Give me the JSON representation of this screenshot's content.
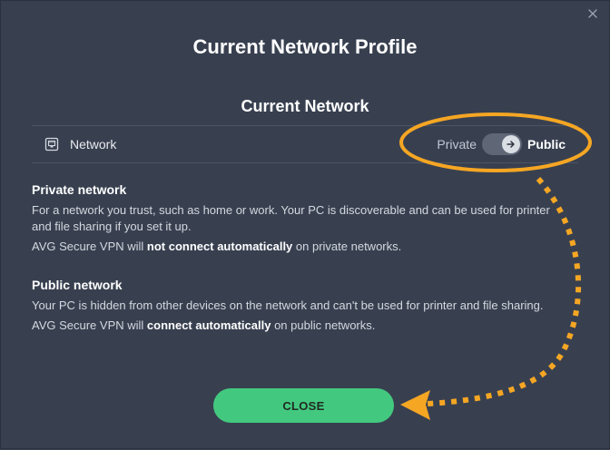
{
  "dialog": {
    "title": "Current Network Profile",
    "section_title": "Current Network",
    "close_icon": "close-icon"
  },
  "network": {
    "icon": "ethernet-port-icon",
    "name": "Network",
    "toggle": {
      "left_label": "Private",
      "right_label": "Public",
      "state": "public"
    }
  },
  "private": {
    "heading": "Private network",
    "line1": "For a network you trust, such as home or work. Your PC is discoverable and can be used for printer and file sharing if you set it up.",
    "line2_pre": "AVG Secure VPN will ",
    "line2_bold": "not connect automatically",
    "line2_post": " on private networks."
  },
  "public": {
    "heading": "Public network",
    "line1": "Your PC is hidden from other devices on the network and can't be used for printer and file sharing.",
    "line2_pre": "AVG Secure VPN will ",
    "line2_bold": "connect automatically",
    "line2_post": " on public networks."
  },
  "button": {
    "close_label": "CLOSE"
  },
  "colors": {
    "background": "#384050",
    "accent_green": "#43c97f",
    "annotation_orange": "#f5a623"
  }
}
